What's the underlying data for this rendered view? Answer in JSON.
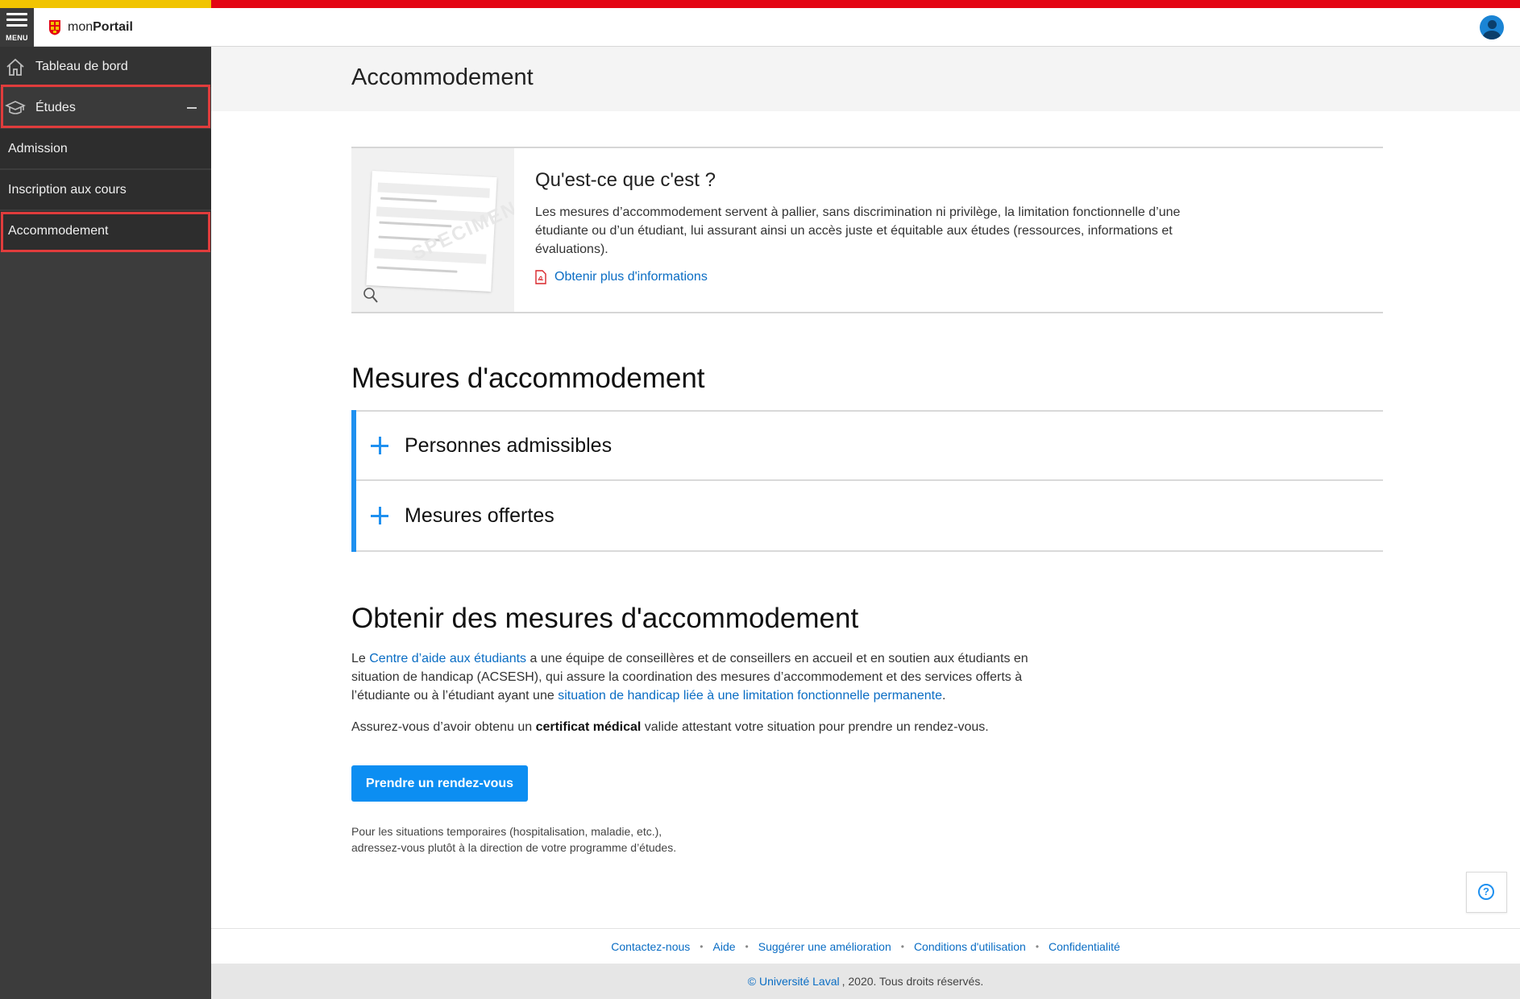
{
  "topbar": {
    "menu_label": "MENU",
    "brand_prefix": "mon",
    "brand_name": "Portail",
    "accent_colors": {
      "yellow": "#f1c400",
      "red": "#e30513"
    }
  },
  "sidebar": {
    "items": [
      {
        "label": "Tableau de bord",
        "icon": "home-icon"
      },
      {
        "label": "Études",
        "icon": "graduation-cap-icon",
        "expanded": true
      },
      {
        "label": "Admission"
      },
      {
        "label": "Inscription aux cours"
      },
      {
        "label": "Accommodement",
        "active": true
      }
    ]
  },
  "page": {
    "title": "Accommodement"
  },
  "info_card": {
    "title": "Qu'est-ce que c'est ?",
    "text": "Les mesures d’accommodement servent à pallier, sans discrimination ni privilège, la limitation fonctionnelle d’une étudiante ou d’un étudiant, lui assurant ainsi un accès juste et équitable aux études (ressources, informations et évaluations).",
    "link_label": "Obtenir plus d'informations",
    "link_icon": "pdf-icon"
  },
  "mesures": {
    "title": "Mesures d'accommodement",
    "accordion": [
      {
        "label": "Personnes admissibles"
      },
      {
        "label": "Mesures offertes"
      }
    ]
  },
  "obtenir": {
    "title": "Obtenir des mesures d'accommodement",
    "p1_prefix": "Le",
    "p1_link1": "Centre d’aide aux étudiants",
    "p1_middle": "a une équipe de conseillères et de conseillers en accueil et en soutien aux étudiants en situation de handicap (ACSESH), qui assure la coordination des mesures d’accommodement et des services offerts à l’étudiante ou à l’étudiant ayant une",
    "p1_link2": "situation de handicap liée à une limitation fonctionnelle permanente",
    "p1_end": ".",
    "p2_prefix": "Assurez-vous d’avoir obtenu un",
    "p2_strong": "certificat médical",
    "p2_suffix": "valide attestant votre situation pour prendre un rendez-vous.",
    "cta_label": "Prendre un rendez-vous",
    "note_line1": "Pour les situations temporaires (hospitalisation, maladie, etc.),",
    "note_line2": "adressez-vous plutôt à la direction de votre programme d’études."
  },
  "help": {
    "icon": "help-circle-icon",
    "glyph": "?"
  },
  "footer": {
    "links": [
      "Contactez-nous",
      "Aide",
      "Suggérer une amélioration",
      "Conditions d'utilisation",
      "Confidentialité"
    ],
    "separator": "•",
    "copyright_link": "© Université Laval",
    "copyright_text": ", 2020. Tous droits réservés."
  }
}
